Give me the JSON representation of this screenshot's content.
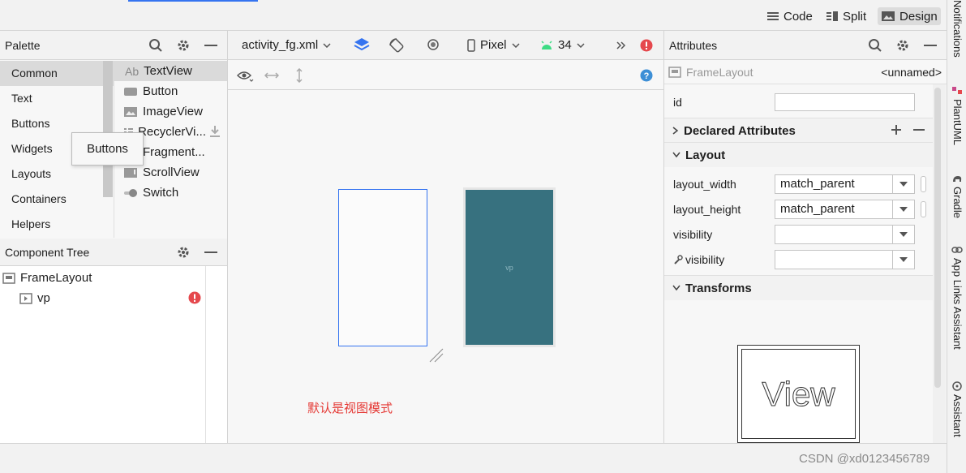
{
  "colors": {
    "accent": "#3574f0",
    "error": "#e5484d",
    "design_bg": "#37717f",
    "annotation": "#e53935",
    "android": "#3ddc84"
  },
  "view_modes": {
    "code": "Code",
    "split": "Split",
    "design": "Design"
  },
  "palette": {
    "title": "Palette",
    "categories": [
      "Common",
      "Text",
      "Buttons",
      "Widgets",
      "Layouts",
      "Containers",
      "Helpers"
    ],
    "items": [
      {
        "label": "TextView",
        "icon": "Ab"
      },
      {
        "label": "Button",
        "icon": "button-icon"
      },
      {
        "label": "ImageView",
        "icon": "image-icon"
      },
      {
        "label": "RecyclerVi...",
        "icon": "list-icon"
      },
      {
        "label": "Fragment...",
        "icon": "fragment-icon"
      },
      {
        "label": "ScrollView",
        "icon": "scroll-icon"
      },
      {
        "label": "Switch",
        "icon": "switch-icon"
      }
    ],
    "tooltip": "Buttons"
  },
  "tree": {
    "title": "Component Tree",
    "root": "FrameLayout",
    "child": "vp"
  },
  "editor": {
    "file": "activity_fg.xml",
    "device": "Pixel",
    "api": "34",
    "blueprint_label": "vp",
    "annotation": "默认是视图模式"
  },
  "attributes": {
    "title": "Attributes",
    "component": "FrameLayout",
    "component_name": "<unnamed>",
    "id_label": "id",
    "declared": "Declared Attributes",
    "layout": "Layout",
    "rows": [
      {
        "label": "layout_width",
        "value": "match_parent"
      },
      {
        "label": "layout_height",
        "value": "match_parent"
      },
      {
        "label": "visibility",
        "value": ""
      },
      {
        "label": "visibility",
        "value": ""
      }
    ],
    "transforms": "Transforms",
    "preview": "View"
  },
  "side_tools": [
    "Notifications",
    "PlantUML",
    "Gradle",
    "App Links Assistant",
    "Assistant"
  ],
  "watermark": "CSDN @xd0123456789"
}
